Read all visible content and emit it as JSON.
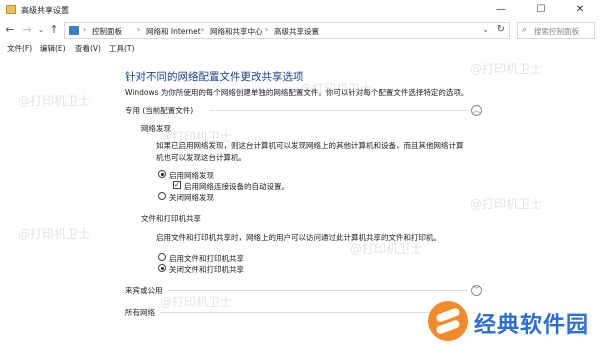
{
  "window": {
    "title": "高级共享设置",
    "minimize": "—",
    "maximize": "☐",
    "close": "✕"
  },
  "nav": {
    "back": "←",
    "forward": "→",
    "recent": "⌄",
    "up": "↑",
    "breadcrumb": [
      "控制面板",
      "网络和 Internet",
      "网络和共享中心",
      "高级共享设置"
    ],
    "breadcrumb_sep": "›",
    "dropdown": "⌄",
    "refresh": "↻"
  },
  "search": {
    "placeholder": "搜索控制面板"
  },
  "menu": {
    "file": "文件(F)",
    "edit": "编辑(E)",
    "view": "查看(V)",
    "tools": "工具(T)"
  },
  "main": {
    "heading": "针对不同的网络配置文件更改共享选项",
    "description": "Windows 为你所使用的每个网络创建单独的网络配置文件。你可以针对每个配置文件选择特定的选项。",
    "private": {
      "label": "专用 (当前配置文件)",
      "chevron": "︿",
      "discovery": {
        "title": "网络发现",
        "text": "如果已启用网络发现，则这台计算机可以发现网络上的其他计算机和设备，而且其他网络计算机也可以发现这台计算机。",
        "opt_on": "启用网络发现",
        "auto_setup": "启用网络连接设备的自动设置。",
        "opt_off": "关闭网络发现"
      },
      "sharing": {
        "title": "文件和打印机共享",
        "text": "启用文件和打印机共享时，网络上的用户可以访问通过此计算机共享的文件和打印机。",
        "opt_on": "启用文件和打印机共享",
        "opt_off": "关闭文件和打印机共享"
      }
    },
    "guest": {
      "label": "来宾或公用",
      "chevron": "﹀"
    },
    "all": {
      "label": "所有网络",
      "chevron": "﹀"
    }
  },
  "state": {
    "discovery_on": true,
    "auto_setup_checked": true,
    "sharing_on": false
  },
  "watermark": "@打印机卫士",
  "brand": {
    "name": "经典软件园"
  }
}
